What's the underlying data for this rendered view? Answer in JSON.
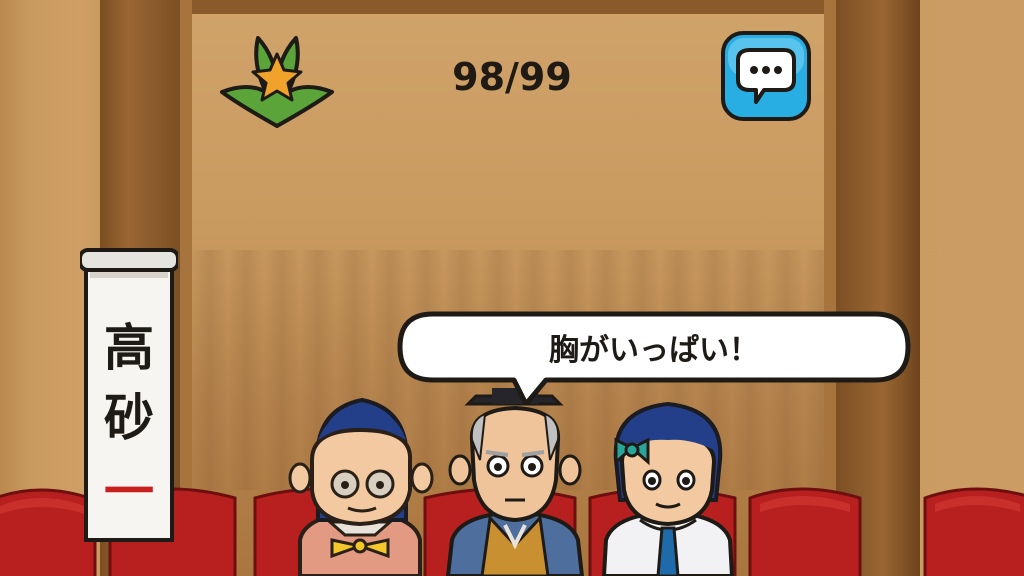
{
  "hud": {
    "progress_text": "98/99"
  },
  "banner": {
    "characters": [
      "高",
      "砂",
      "一"
    ]
  },
  "speech": {
    "text": "胸がいっぱい！"
  },
  "colors": {
    "leaf_green": "#5aa43a",
    "star_orange": "#f0a22b",
    "chat_blue": "#29aee4",
    "seat_red": "#b8201f",
    "banner_red": "#c81e1e"
  },
  "icons": {
    "leaf": "bamboo-leaf-star-icon",
    "chat": "chat-bubble-icon"
  }
}
